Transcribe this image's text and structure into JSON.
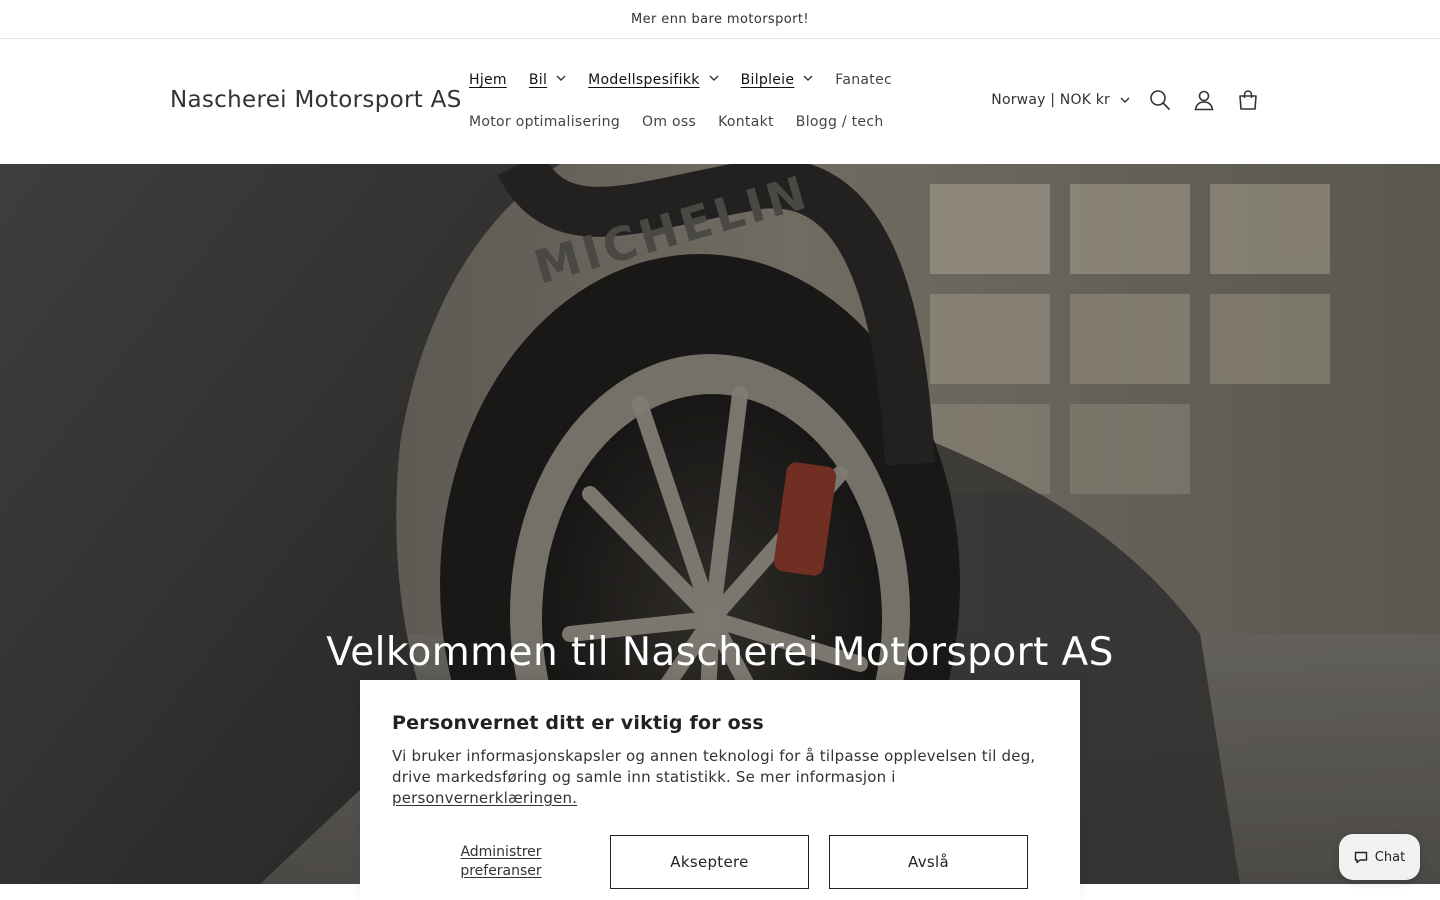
{
  "announcement": {
    "text": "Mer enn bare motorsport!"
  },
  "header": {
    "brand": "Nascherei Motorsport AS",
    "nav_row1": [
      {
        "label": "Hjem",
        "dropdown": false,
        "underlined": true
      },
      {
        "label": "Bil",
        "dropdown": true,
        "underlined": true
      },
      {
        "label": "Modellspesifikk",
        "dropdown": true,
        "underlined": true
      },
      {
        "label": "Bilpleie",
        "dropdown": true,
        "underlined": true
      },
      {
        "label": "Fanatec",
        "dropdown": false,
        "underlined": false
      }
    ],
    "nav_row2": [
      {
        "label": "Motor optimalisering"
      },
      {
        "label": "Om oss"
      },
      {
        "label": "Kontakt"
      },
      {
        "label": "Blogg / tech"
      }
    ],
    "localization": "Norway | NOK kr",
    "icons": [
      "search-icon",
      "account-icon",
      "cart-icon"
    ]
  },
  "hero": {
    "title": "Velkommen til Nascherei Motorsport AS",
    "tire_text": "MICHELIN"
  },
  "cookie_banner": {
    "title": "Personvernet ditt er viktig for oss",
    "body": "Vi bruker informasjonskapsler og annen teknologi for å tilpasse opplevelsen til deg, drive markedsføring og samle inn statistikk. Se mer informasjon i",
    "link": "personvernerklæringen.",
    "manage": "Administrer preferanser",
    "accept": "Akseptere",
    "decline": "Avslå"
  },
  "chat": {
    "label": "Chat"
  },
  "colors": {
    "text": "#121212",
    "overlay": "#000000",
    "chat_bg": "#f1f1f1"
  }
}
